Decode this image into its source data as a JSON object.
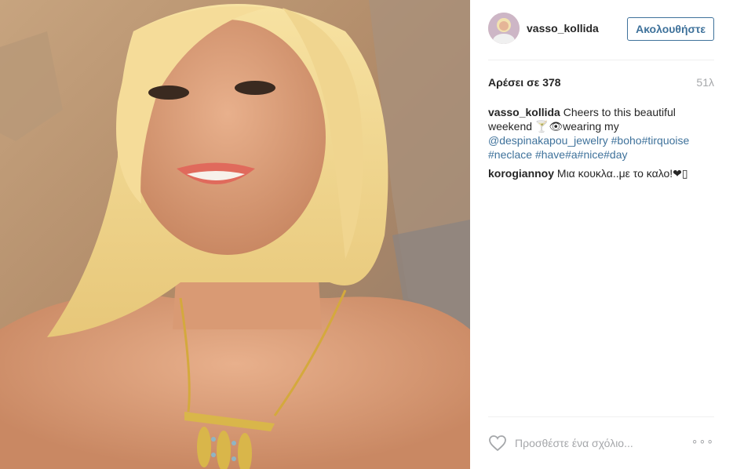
{
  "post": {
    "image_alt": "Photo of a smiling blonde woman wearing a gold necklace against a rock background"
  },
  "header": {
    "username": "vasso_kollida",
    "follow_label": "Ακολουθήστε"
  },
  "stats": {
    "likes_text": "Αρέσει σε 378",
    "time_text": "51λ"
  },
  "caption": {
    "user": "vasso_kollida",
    "text": "Cheers to this beautiful weekend 🍸👁wearing my",
    "links": [
      "@despinakapou_jewelry",
      "#boho",
      "#tirquoise",
      "#neclace",
      "#have",
      "#a",
      "#nice",
      "#day"
    ]
  },
  "comments": [
    {
      "user": "korogiannoy",
      "text": "Μια κουκλα..με το καλο!❤▯"
    }
  ],
  "footer": {
    "comment_placeholder": "Προσθέστε ένα σχόλιο...",
    "more_label": "∘∘∘"
  },
  "colors": {
    "link": "#3f729b",
    "text": "#262626",
    "muted": "#a5a7aa"
  }
}
